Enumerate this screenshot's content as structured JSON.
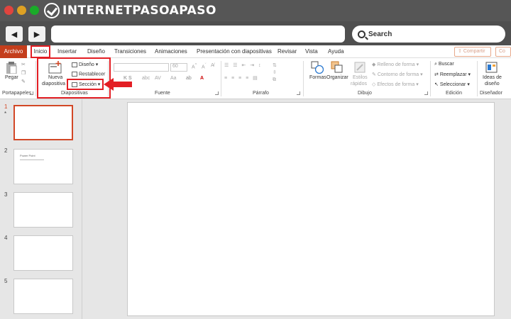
{
  "brand": {
    "logo_text": "INTERNETPASOAPASO"
  },
  "browser": {
    "back_icon": "◀",
    "forward_icon": "▶",
    "search_label": "Search"
  },
  "ribbon_tabs": [
    "Archivo",
    "Inicio",
    "Insertar",
    "Diseño",
    "Transiciones",
    "Animaciones",
    "Presentación con diapositivas",
    "Revisar",
    "Vista",
    "Ayuda"
  ],
  "ribbon_right": {
    "share_label": "Compartir",
    "comments_label": "Co"
  },
  "groups": {
    "portapapeles": {
      "label": "Portapapeles",
      "paste_label": "Pegar"
    },
    "diapositivas": {
      "label": "Diapositivas",
      "new_slide_label_1": "Nueva",
      "new_slide_label_2": "diapositiva",
      "layout_label": "Diseño",
      "reset_label": "Restablecer",
      "section_label": "Sección"
    },
    "fuente": {
      "label": "Fuente",
      "font_size": "60"
    },
    "parrafo": {
      "label": "Párrafo"
    },
    "dibujo": {
      "label": "Dibujo",
      "shapes_label": "Formas",
      "arrange_label": "Organizar",
      "styles_label_1": "Estilos",
      "styles_label_2": "rápidos",
      "fill_label": "Relleno de forma",
      "outline_label": "Contorno de forma",
      "effects_label": "Efectos de forma"
    },
    "edicion": {
      "label": "Edición",
      "find_label": "Buscar",
      "replace_label": "Reemplazar",
      "select_label": "Seleccionar"
    },
    "disenador": {
      "label": "Diseñador",
      "ideas_label_1": "Ideas de",
      "ideas_label_2": "diseño"
    }
  },
  "slides": [
    {
      "number": "1",
      "selected": true,
      "star": "*"
    },
    {
      "number": "2",
      "title": "Power Point"
    },
    {
      "number": "3"
    },
    {
      "number": "4"
    },
    {
      "number": "5"
    }
  ],
  "colors": {
    "accent": "#c43e1c",
    "highlight": "#e31e24"
  }
}
